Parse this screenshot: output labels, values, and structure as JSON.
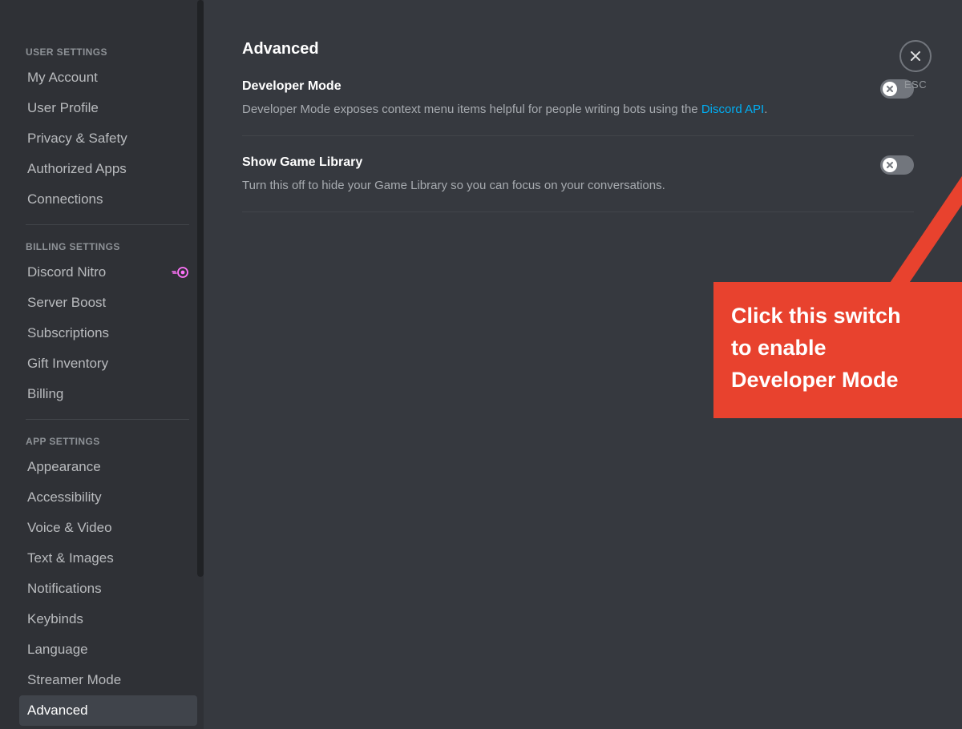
{
  "page_title": "Advanced",
  "close_label": "ESC",
  "sidebar": {
    "sections": [
      {
        "header": "USER SETTINGS",
        "items": [
          {
            "key": "my-account",
            "label": "My Account"
          },
          {
            "key": "user-profile",
            "label": "User Profile"
          },
          {
            "key": "privacy-safety",
            "label": "Privacy & Safety"
          },
          {
            "key": "authorized-apps",
            "label": "Authorized Apps"
          },
          {
            "key": "connections",
            "label": "Connections"
          }
        ]
      },
      {
        "header": "BILLING SETTINGS",
        "items": [
          {
            "key": "discord-nitro",
            "label": "Discord Nitro",
            "badge": "nitro"
          },
          {
            "key": "server-boost",
            "label": "Server Boost"
          },
          {
            "key": "subscriptions",
            "label": "Subscriptions"
          },
          {
            "key": "gift-inventory",
            "label": "Gift Inventory"
          },
          {
            "key": "billing",
            "label": "Billing"
          }
        ]
      },
      {
        "header": "APP SETTINGS",
        "items": [
          {
            "key": "appearance",
            "label": "Appearance"
          },
          {
            "key": "accessibility",
            "label": "Accessibility"
          },
          {
            "key": "voice-video",
            "label": "Voice & Video"
          },
          {
            "key": "text-images",
            "label": "Text & Images"
          },
          {
            "key": "notifications",
            "label": "Notifications"
          },
          {
            "key": "keybinds",
            "label": "Keybinds"
          },
          {
            "key": "language",
            "label": "Language"
          },
          {
            "key": "streamer-mode",
            "label": "Streamer Mode"
          },
          {
            "key": "advanced",
            "label": "Advanced",
            "active": true
          }
        ]
      }
    ]
  },
  "settings": [
    {
      "key": "developer-mode",
      "title": "Developer Mode",
      "desc_pre": "Developer Mode exposes context menu items helpful for people writing bots using the ",
      "link_text": "Discord API",
      "desc_post": ".",
      "enabled": false
    },
    {
      "key": "show-game-library",
      "title": "Show Game Library",
      "desc_pre": "Turn this off to hide your Game Library so you can focus on your conversations.",
      "link_text": "",
      "desc_post": "",
      "enabled": false
    }
  ],
  "annotation": {
    "text_line1": "Click this switch",
    "text_line2": "to enable",
    "text_line3": "Developer Mode",
    "highlight_color": "#e8422e"
  }
}
